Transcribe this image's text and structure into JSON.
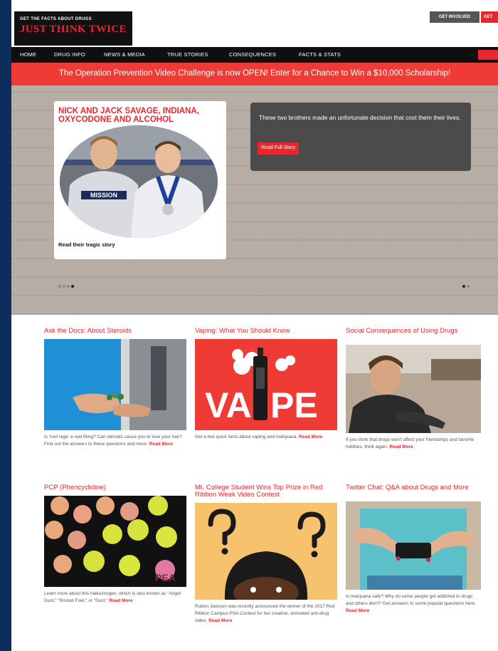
{
  "header": {
    "logo_tagline": "GET THE FACTS ABOUT DRUGS",
    "logo_title": "JUST THINK TWICE",
    "get_involved_label": "GET INVOLVED",
    "get_label": "GET"
  },
  "nav": {
    "items": [
      "HOME",
      "DRUG INFO",
      "NEWS & MEDIA",
      "TRUE STORIES",
      "CONSEQUENCES",
      "FACTS & STATS"
    ]
  },
  "banner": {
    "text": "The Operation Prevention Video Challenge is now OPEN!  Enter for a Chance to Win a $10,000 Scholarship!"
  },
  "hero": {
    "title": "NICK AND JACK SAVAGE, INDIANA, OXYCODONE AND ALCOHOL",
    "subtitle": "Read their tragic story",
    "description": "These two brothers made an unfortunate decision that cost them their lives.",
    "button_label": "Read Full Story",
    "jersey_text": "MISSION"
  },
  "articles": [
    {
      "title": "Ask the Docs: About Steroids",
      "text": "Is 'roid rage' a real thing? Can steroids cause you to lose your hair? Find out the answers to these questions and more.",
      "more": "Read More"
    },
    {
      "title": "Vaping: What You Should Know",
      "text": "Get a few quick facts about vaping and marijuana.",
      "more": "Read More",
      "image_word_a": "VA",
      "image_word_b": "PE"
    },
    {
      "title": "Social Consequences of Using Drugs",
      "text": "If you think that drugs won't affect your friendships and favorite hobbies, think again.",
      "more": "Read More"
    },
    {
      "title": "PCP (Phencyclidine)",
      "text": "Learn more about this hallucinogen, which is also known as \"Angel Dust,\" \"Rocket Fuel,\" or \"Dust.\"",
      "more": "Read More",
      "pill_label": "PEA"
    },
    {
      "title": "Mt. College Student Wins Top Prize in Red Ribbon Week Video Contest",
      "text": "Ruben Jackson was recently announced the winner of the 2017 Red Ribbon Campus PSA Contest for her creative, animated anti-drug video.",
      "more": "Read More"
    },
    {
      "title": "Twitter Chat: Q&A about Drugs and More",
      "text": "Is marijuana safe? Why do some people get addicted to drugs and others don't? Get answers to some popular questions here.",
      "more": "Read More"
    }
  ],
  "colors": {
    "brand_red": "#e8262d",
    "nav_black": "#0f0f0f",
    "page_bg": "#0d2d5c"
  }
}
